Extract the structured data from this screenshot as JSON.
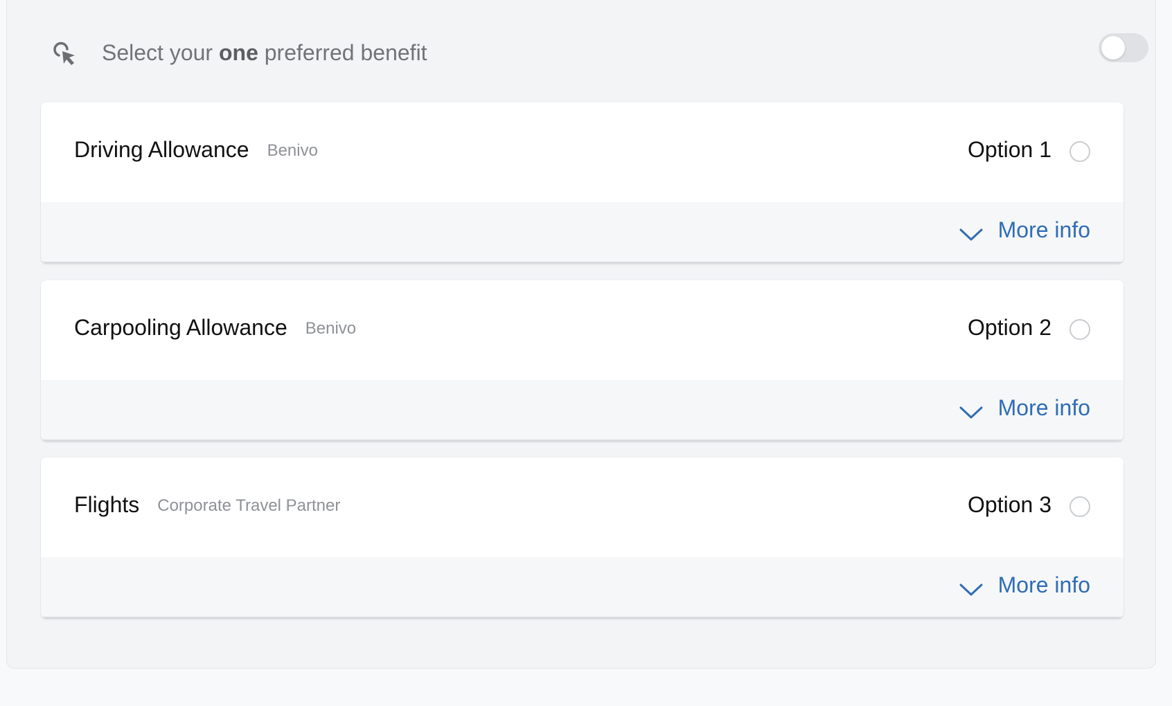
{
  "header": {
    "title_before": "Select your ",
    "title_bold": "one",
    "title_after": " preferred benefit",
    "icon": "cursor-pointer-icon",
    "toggle_on": false
  },
  "colors": {
    "link": "#2f6db5",
    "panel_bg": "#f3f4f6",
    "card_bg": "#ffffff",
    "footer_bg": "#f6f7f8"
  },
  "benefits": [
    {
      "name": "Driving Allowance",
      "provider": "Benivo",
      "option": "Option 1",
      "more_info": "More info",
      "selected": false
    },
    {
      "name": "Carpooling Allowance",
      "provider": "Benivo",
      "option": "Option 2",
      "more_info": "More info",
      "selected": false
    },
    {
      "name": "Flights",
      "provider": "Corporate Travel Partner",
      "option": "Option 3",
      "more_info": "More info",
      "selected": false
    }
  ]
}
